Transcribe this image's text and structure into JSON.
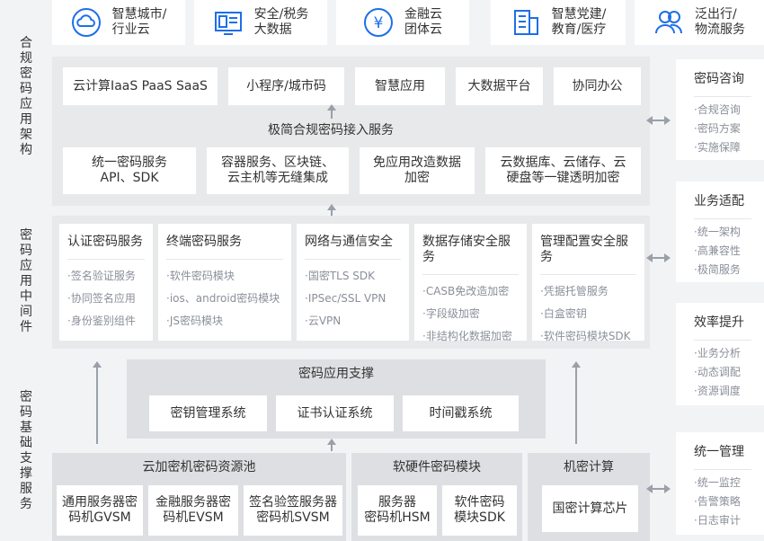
{
  "colors": {
    "accent": "#1e6fe8",
    "panel": "#e8e9eb",
    "card": "#ffffff",
    "muted": "#8a8f99",
    "arrow": "#9aa0a8"
  },
  "top_cards": [
    {
      "icon": "cloud-icon",
      "line1": "智慧城市/",
      "line2": "行业云"
    },
    {
      "icon": "monitor-icon",
      "line1": "安全/税务",
      "line2": "大数据"
    },
    {
      "icon": "yuan-coin-icon",
      "line1": "金融云",
      "line2": "团体云"
    },
    {
      "icon": "building-icon",
      "line1": "智慧党建/",
      "line2": "教育/医疗"
    },
    {
      "icon": "users-icon",
      "line1": "泛出行/",
      "line2": "物流服务"
    }
  ],
  "side_labels": {
    "compliance": "合规密码应用架构",
    "middleware": "密码应用中间件",
    "infrastructure": "密码基础支撑服务"
  },
  "compliance": {
    "apps": [
      "云计算IaaS PaaS SaaS",
      "小程序/城市码",
      "智慧应用",
      "大数据平台",
      "协同办公"
    ],
    "access_title": "极简合规密码接入服务",
    "services": [
      {
        "line1": "统一密码服务",
        "line2": "API、SDK"
      },
      {
        "line1": "容器服务、区块链、",
        "line2": "云主机等无缝集成"
      },
      {
        "line1": "免应用改造数据",
        "line2": "加密"
      },
      {
        "line1": "云数据库、云储存、云",
        "line2": "硬盘等一键透明加密"
      }
    ]
  },
  "middleware": [
    {
      "title": "认证密码服务",
      "items": [
        "·签名验证服务",
        "·协同签名应用",
        "·身份鉴别组件"
      ]
    },
    {
      "title": "终端密码服务",
      "items": [
        "·软件密码模块",
        "·ios、android密码模块",
        "·JS密码模块"
      ]
    },
    {
      "title": "网络与通信安全",
      "items": [
        "·国密TLS SDK",
        "·IPSec/SSL VPN",
        "·云VPN"
      ]
    },
    {
      "title": "数据存储安全服务",
      "items": [
        "·CASB免改造加密",
        "·字段级加密",
        "·非结构化数据加密"
      ]
    },
    {
      "title": "管理配置安全服务",
      "items": [
        "·凭据托管服务",
        "·白盒密钥",
        "·软件密码模块SDK"
      ]
    }
  ],
  "support": {
    "title": "密码应用支撑",
    "items": [
      "密钥管理系统",
      "证书认证系统",
      "时间戳系统"
    ]
  },
  "pools": [
    {
      "title": "云加密机密码资源池",
      "items": [
        {
          "line1": "通用服务器密",
          "line2": "码机GVSM"
        },
        {
          "line1": "金融服务器密",
          "line2": "码机EVSM"
        },
        {
          "line1": "签名验签服务器",
          "line2": "密码机SVSM"
        }
      ]
    },
    {
      "title": "软硬件密码模块",
      "items": [
        {
          "line1": "服务器",
          "line2": "密码机HSM"
        },
        {
          "line1": "软件密码",
          "line2": "模块SDK"
        }
      ]
    },
    {
      "title": "机密计算",
      "items": [
        {
          "line1": "国密计算芯片",
          "line2": ""
        }
      ]
    }
  ],
  "right_cards": [
    {
      "title": "密码咨询",
      "items": [
        "·合规咨询",
        "·密码方案",
        "·实施保障"
      ]
    },
    {
      "title": "业务适配",
      "items": [
        "·统一架构",
        "·高兼容性",
        "·极简服务"
      ]
    },
    {
      "title": "效率提升",
      "items": [
        "·业务分析",
        "·动态调配",
        "·资源调度"
      ]
    },
    {
      "title": "统一管理",
      "items": [
        "·统一监控",
        "·告警策略",
        "·日志审计"
      ]
    }
  ]
}
